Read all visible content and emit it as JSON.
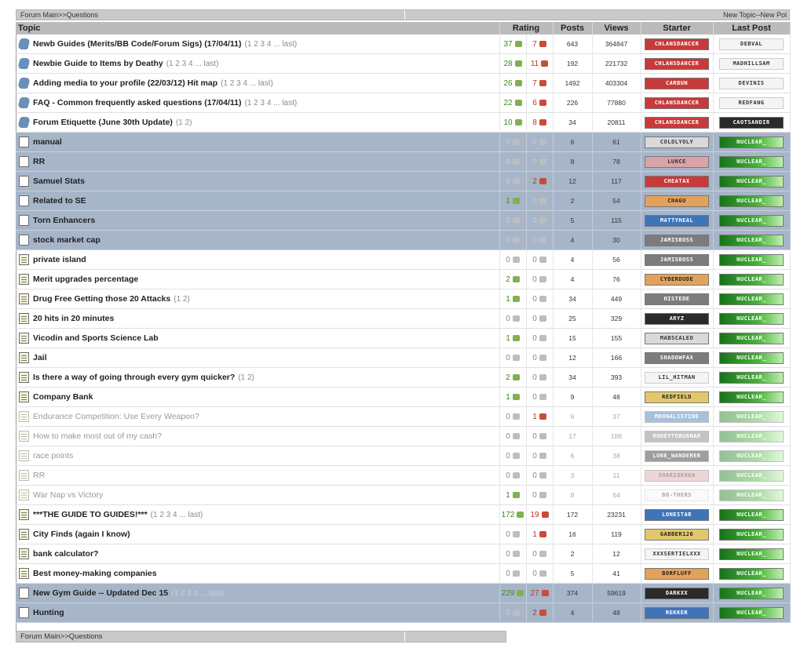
{
  "breadcrumb": {
    "text": "Forum Main>>Questions",
    "new_actions": "New Topic--New Pol"
  },
  "headers": {
    "topic": "Topic",
    "rating": "Rating",
    "posts": "Posts",
    "views": "Views",
    "starter": "Starter",
    "last_post": "Last Post"
  },
  "topics": [
    {
      "title": "Newb Guides (Merits/BB Code/Forum Sigs) (17/04/11)",
      "pages": "(1 2 3 4 ... last)",
      "likes": "37",
      "dislikes": "7",
      "posts": "643",
      "views": "364847",
      "starter": "CHLANSDANCER",
      "last": "DEBVAL",
      "kind": "pinned",
      "sb": "b-red",
      "lb": "b-white"
    },
    {
      "title": "Newbie Guide to Items by Deathy",
      "pages": "(1 2 3 4 ... last)",
      "likes": "28",
      "dislikes": "11",
      "posts": "192",
      "views": "221732",
      "starter": "CHLANSDANCER",
      "last": "MADHILLSAM",
      "kind": "pinned",
      "sb": "b-red",
      "lb": "b-white"
    },
    {
      "title": "Adding media to your profile (22/03/12) Hit map",
      "pages": "(1 2 3 4 ... last)",
      "likes": "26",
      "dislikes": "7",
      "posts": "1492",
      "views": "403304",
      "starter": "CARBUN",
      "last": "DEVINIS",
      "kind": "pinned",
      "sb": "b-red",
      "lb": "b-white"
    },
    {
      "title": "FAQ - Common frequently asked questions (17/04/11)",
      "pages": "(1 2 3 4 ... last)",
      "likes": "22",
      "dislikes": "6",
      "posts": "226",
      "views": "77880",
      "starter": "CHLANSDANCER",
      "last": "REDFANG",
      "kind": "pinned",
      "sb": "b-red",
      "lb": "b-white"
    },
    {
      "title": "Forum Etiquette (June 30th Update)",
      "pages": "(1 2)",
      "likes": "10",
      "dislikes": "8",
      "posts": "34",
      "views": "20811",
      "starter": "CHLANSDANCER",
      "last": "CAOTSANDIR",
      "kind": "pinned",
      "sb": "b-red",
      "lb": "b-dark"
    },
    {
      "title": "manual",
      "pages": "",
      "likes": "0",
      "dislikes": "0",
      "posts": "6",
      "views": "61",
      "starter": "COLDLYOLY",
      "last": "NUCLEAR_",
      "kind": "sticky",
      "sb": "b-light",
      "lb": "b-green"
    },
    {
      "title": "RR",
      "pages": "",
      "likes": "0",
      "dislikes": "0",
      "posts": "8",
      "views": "78",
      "starter": "LUNCE",
      "last": "NUCLEAR_",
      "kind": "sticky",
      "sb": "b-pink",
      "lb": "b-green"
    },
    {
      "title": "Samuel Stats",
      "pages": "",
      "likes": "0",
      "dislikes": "2",
      "posts": "12",
      "views": "117",
      "starter": "CHEATAX",
      "last": "NUCLEAR_",
      "kind": "sticky",
      "sb": "b-red",
      "lb": "b-green"
    },
    {
      "title": "Related to SE",
      "pages": "",
      "likes": "1",
      "dislikes": "0",
      "posts": "2",
      "views": "54",
      "starter": "CHAGU",
      "last": "NUCLEAR_",
      "kind": "sticky",
      "sb": "b-orange",
      "lb": "b-green"
    },
    {
      "title": "Torn Enhancers",
      "pages": "",
      "likes": "0",
      "dislikes": "0",
      "posts": "5",
      "views": "115",
      "starter": "MATTYHEAL",
      "last": "NUCLEAR_",
      "kind": "sticky",
      "sb": "b-blue",
      "lb": "b-green"
    },
    {
      "title": "stock market cap",
      "pages": "",
      "likes": "0",
      "dislikes": "0",
      "posts": "4",
      "views": "30",
      "starter": "JAMISBOSS",
      "last": "NUCLEAR_",
      "kind": "sticky",
      "sb": "b-gray",
      "lb": "b-green"
    },
    {
      "title": "private island",
      "pages": "",
      "likes": "0",
      "dislikes": "0",
      "posts": "4",
      "views": "56",
      "starter": "JAMISBOSS",
      "last": "NUCLEAR_",
      "kind": "normal",
      "sb": "b-gray",
      "lb": "b-green"
    },
    {
      "title": "Merit upgrades percentage",
      "pages": "",
      "likes": "2",
      "dislikes": "0",
      "posts": "4",
      "views": "76",
      "starter": "CYBERDUDE",
      "last": "NUCLEAR_",
      "kind": "normal",
      "sb": "b-orange",
      "lb": "b-green"
    },
    {
      "title": "Drug Free Getting those 20 Attacks",
      "pages": "(1 2)",
      "likes": "1",
      "dislikes": "0",
      "posts": "34",
      "views": "449",
      "starter": "HISTEDE",
      "last": "NUCLEAR_",
      "kind": "normal",
      "sb": "b-gray",
      "lb": "b-green"
    },
    {
      "title": "20 hits in 20 minutes",
      "pages": "",
      "likes": "0",
      "dislikes": "0",
      "posts": "25",
      "views": "329",
      "starter": "ARYZ",
      "last": "NUCLEAR_",
      "kind": "normal",
      "sb": "b-dark",
      "lb": "b-green"
    },
    {
      "title": "Vicodin and Sports Science Lab",
      "pages": "",
      "likes": "1",
      "dislikes": "0",
      "posts": "15",
      "views": "155",
      "starter": "MABSCALEO",
      "last": "NUCLEAR_",
      "kind": "normal",
      "sb": "b-light",
      "lb": "b-green"
    },
    {
      "title": "Jail",
      "pages": "",
      "likes": "0",
      "dislikes": "0",
      "posts": "12",
      "views": "166",
      "starter": "SHADOWFAX",
      "last": "NUCLEAR_",
      "kind": "normal",
      "sb": "b-gray",
      "lb": "b-green"
    },
    {
      "title": "Is there a way of going through every gym quicker?",
      "pages": "(1 2)",
      "likes": "2",
      "dislikes": "0",
      "posts": "34",
      "views": "393",
      "starter": "LIL_HITMAN",
      "last": "NUCLEAR_",
      "kind": "normal",
      "sb": "b-white",
      "lb": "b-green"
    },
    {
      "title": "Company Bank",
      "pages": "",
      "likes": "1",
      "dislikes": "0",
      "posts": "9",
      "views": "48",
      "starter": "REDFIELD",
      "last": "NUCLEAR_",
      "kind": "normal",
      "sb": "b-yellow",
      "lb": "b-green"
    },
    {
      "title": "Endurance Competition: Use Every Weapon?",
      "pages": "",
      "likes": "0",
      "dislikes": "1",
      "posts": "6",
      "views": "37",
      "starter": "MOONALISTINE",
      "last": "NUCLEAR_",
      "kind": "faded",
      "sb": "b-blue",
      "lb": "b-green"
    },
    {
      "title": "How to make most out of my cash?",
      "pages": "",
      "likes": "0",
      "dislikes": "0",
      "posts": "17",
      "views": "188",
      "starter": "MONEYTOBURNAR",
      "last": "NUCLEAR_",
      "kind": "faded",
      "sb": "b-gray",
      "lb": "b-green"
    },
    {
      "title": "race points",
      "pages": "",
      "likes": "0",
      "dislikes": "0",
      "posts": "6",
      "views": "38",
      "starter": "LONE_WANDERER",
      "last": "NUCLEAR_",
      "kind": "faded",
      "sb": "b-dark",
      "lb": "b-green"
    },
    {
      "title": "RR",
      "pages": "",
      "likes": "0",
      "dislikes": "0",
      "posts": "3",
      "views": "11",
      "starter": "SHARIQKHAN",
      "last": "NUCLEAR_",
      "kind": "faded",
      "sb": "b-pink",
      "lb": "b-green"
    },
    {
      "title": "War Nap vs Victory",
      "pages": "",
      "likes": "1",
      "dislikes": "0",
      "posts": "8",
      "views": "64",
      "starter": "BO-THERS",
      "last": "NUCLEAR_",
      "kind": "faded",
      "sb": "b-white",
      "lb": "b-green"
    },
    {
      "title": "***THE GUIDE TO GUIDES!***",
      "pages": "(1 2 3 4 ... last)",
      "likes": "172",
      "dislikes": "19",
      "posts": "172",
      "views": "23231",
      "starter": "LONESTAR",
      "last": "NUCLEAR_",
      "kind": "normal",
      "sb": "b-blue",
      "lb": "b-green"
    },
    {
      "title": "City Finds (again I know)",
      "pages": "",
      "likes": "0",
      "dislikes": "1",
      "posts": "16",
      "views": "119",
      "starter": "GABBER126",
      "last": "NUCLEAR_",
      "kind": "normal",
      "sb": "b-yellow",
      "lb": "b-green"
    },
    {
      "title": "bank calculator?",
      "pages": "",
      "likes": "0",
      "dislikes": "0",
      "posts": "2",
      "views": "12",
      "starter": "XXXSERTIELXXX",
      "last": "NUCLEAR_",
      "kind": "normal",
      "sb": "b-white",
      "lb": "b-green"
    },
    {
      "title": "Best money-making companies",
      "pages": "",
      "likes": "0",
      "dislikes": "0",
      "posts": "5",
      "views": "41",
      "starter": "BORFLUFF",
      "last": "NUCLEAR_",
      "kind": "normal",
      "sb": "b-orange",
      "lb": "b-green"
    },
    {
      "title": "New Gym Guide -- Updated Dec 15",
      "pages": "(1 2 3 4 ... last)",
      "likes": "229",
      "dislikes": "27",
      "posts": "374",
      "views": "59619",
      "starter": "DARKXX",
      "last": "NUCLEAR_",
      "kind": "sticky",
      "sb": "b-dark",
      "lb": "b-green"
    },
    {
      "title": "Hunting",
      "pages": "",
      "likes": "0",
      "dislikes": "2",
      "posts": "4",
      "views": "48",
      "starter": "REKKER",
      "last": "NUCLEAR_",
      "kind": "sticky",
      "sb": "b-blue",
      "lb": "b-green"
    }
  ]
}
